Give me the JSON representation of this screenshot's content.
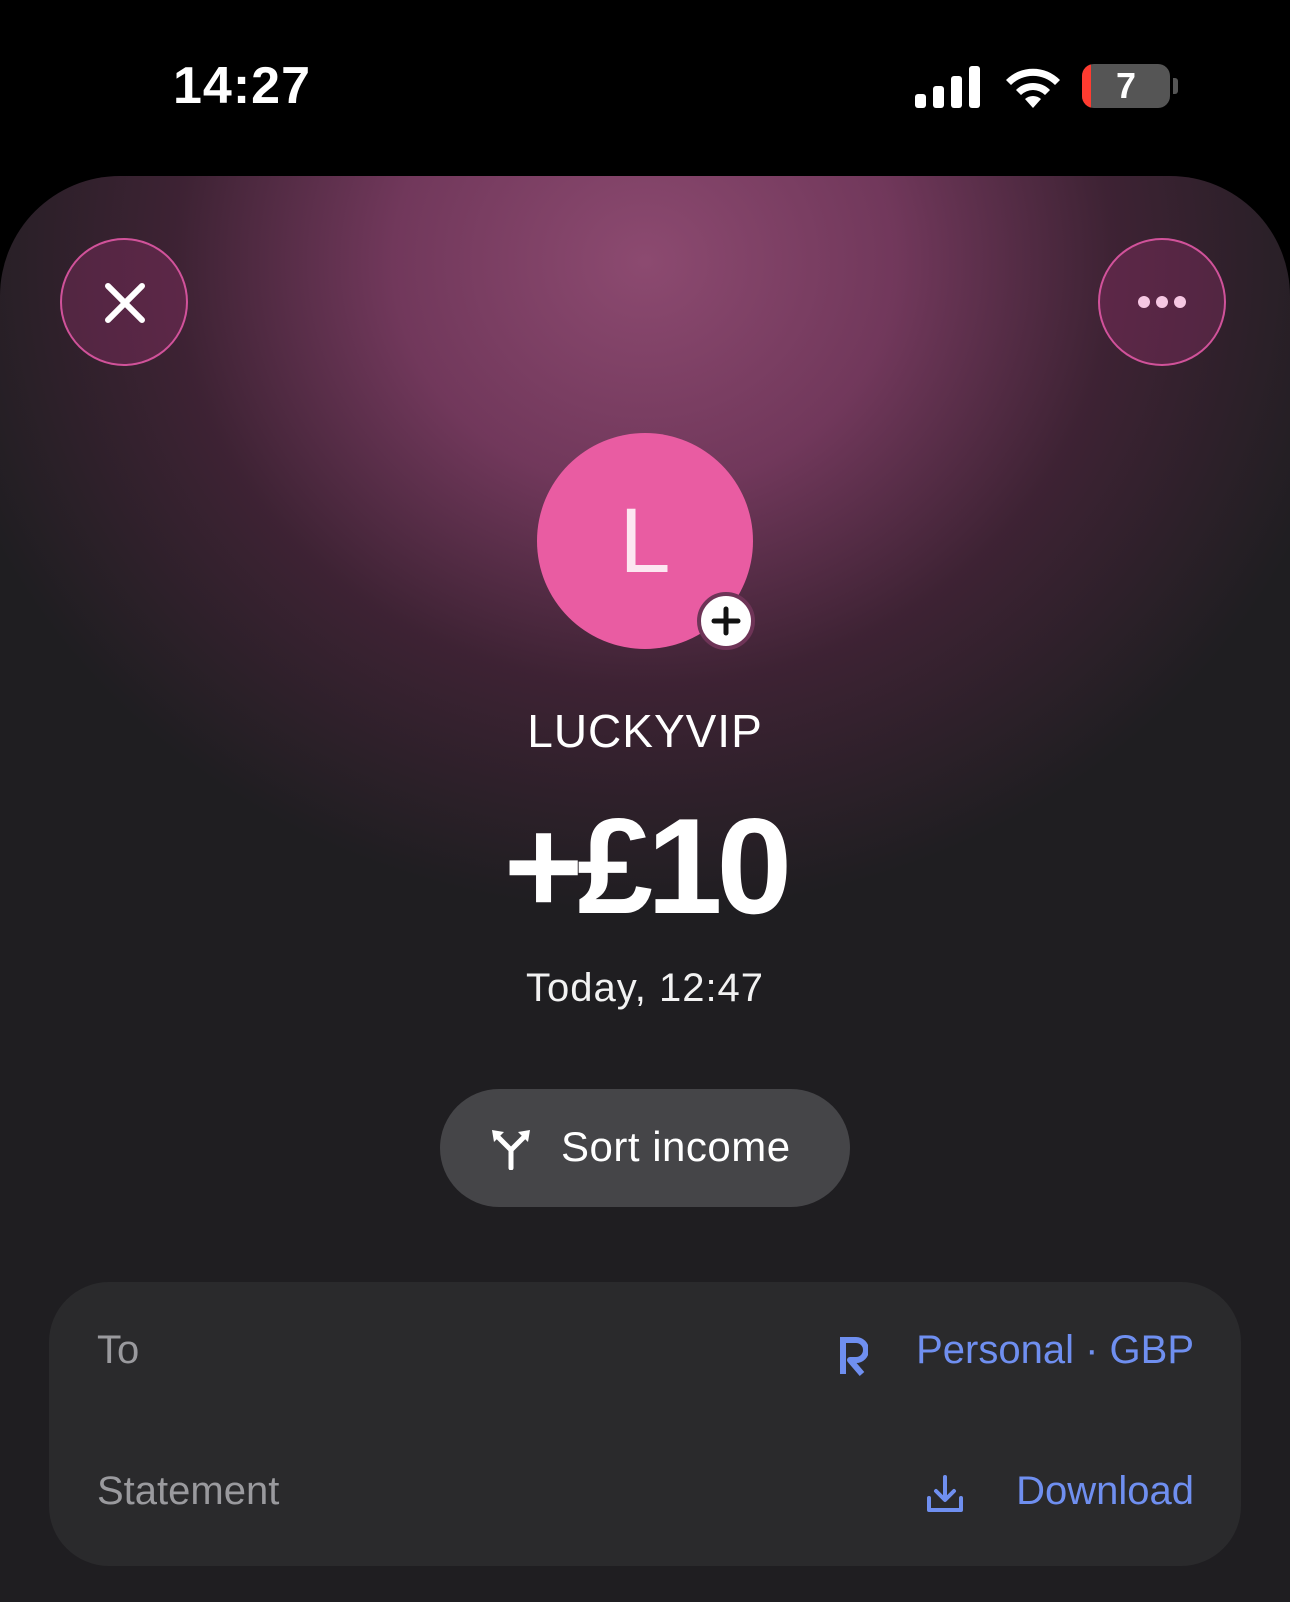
{
  "status_bar": {
    "time": "14:27",
    "battery_level": "7",
    "battery_fraction": 0.07
  },
  "header": {
    "close_icon": "close-icon",
    "more_icon": "more-icon"
  },
  "merchant": {
    "initial": "L",
    "name": "LUCKYVIP",
    "avatar_color": "#e95ca2"
  },
  "transaction": {
    "amount": "+£10",
    "datetime": "Today, 12:47"
  },
  "actions": {
    "sort_label": "Sort income"
  },
  "details": {
    "to_label": "To",
    "to_value": "Personal · GBP",
    "statement_label": "Statement",
    "statement_value": "Download",
    "accent_color": "#6f8ff0"
  }
}
